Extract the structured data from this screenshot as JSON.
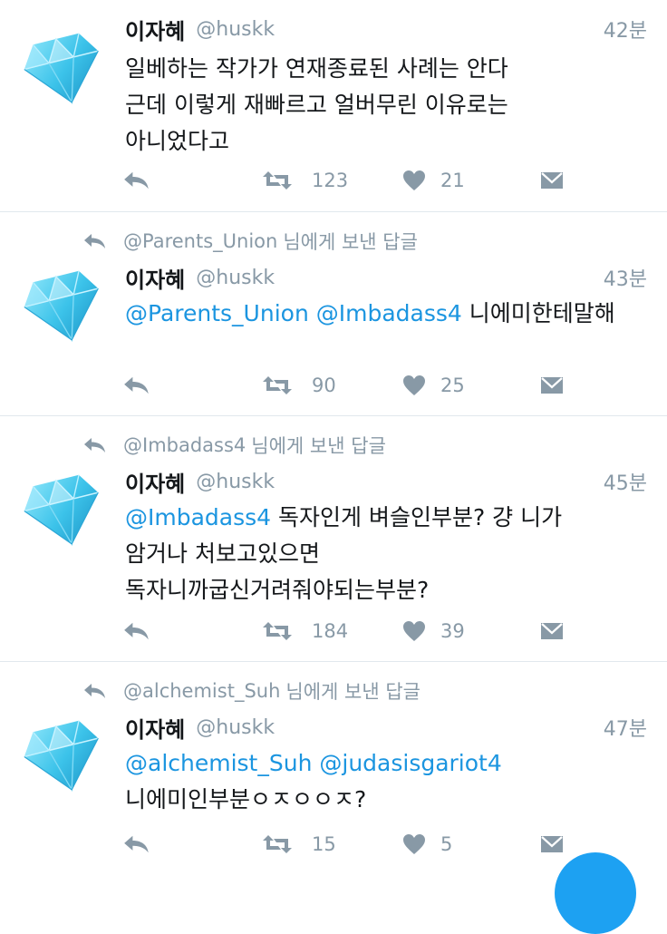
{
  "tweets": [
    {
      "reply_to": null,
      "name": "이자혜",
      "handle": "@huskk",
      "time": "42분",
      "lines": [
        [
          {
            "t": "일베하는 작가가 연재종료된 사례는 안다",
            "m": false
          }
        ],
        [
          {
            "t": "근데 이렇게 재빠르고 얼버무린 이유로는",
            "m": false
          }
        ],
        [
          {
            "t": "아니었다고",
            "m": false
          }
        ]
      ],
      "retweets": "123",
      "likes": "21"
    },
    {
      "reply_to": {
        "handle": "@Parents_Union",
        "suffix": "님에게 보낸 답글"
      },
      "name": "이자혜",
      "handle": "@huskk",
      "time": "43분",
      "lines": [
        [
          {
            "t": "@Parents_Union @Imbadass4",
            "m": true
          },
          {
            "t": " 니에미한테말해",
            "m": false
          }
        ]
      ],
      "retweets": "90",
      "likes": "25"
    },
    {
      "reply_to": {
        "handle": "@Imbadass4",
        "suffix": "님에게 보낸 답글"
      },
      "name": "이자혜",
      "handle": "@huskk",
      "time": "45분",
      "lines": [
        [
          {
            "t": "@Imbadass4",
            "m": true
          },
          {
            "t": " 독자인게 벼슬인부분? 걍 니가",
            "m": false
          }
        ],
        [
          {
            "t": "암거나 처보고있으면",
            "m": false
          }
        ],
        [
          {
            "t": "독자니까굽신거려줘야되는부분?",
            "m": false
          }
        ]
      ],
      "retweets": "184",
      "likes": "39"
    },
    {
      "reply_to": {
        "handle": "@alchemist_Suh",
        "suffix": "님에게 보낸 답글"
      },
      "name": "이자혜",
      "handle": "@huskk",
      "time": "47분",
      "lines": [
        [
          {
            "t": "@alchemist_Suh @judasisgariot4",
            "m": true
          }
        ],
        [
          {
            "t": "니에미인부분ㅇㅈㅇㅇㅈ?",
            "m": false
          }
        ]
      ],
      "retweets": "15",
      "likes": "5"
    }
  ],
  "icons": {
    "reply": "reply-arrow-icon",
    "retweet": "retweet-icon",
    "like": "heart-icon",
    "dm": "envelope-icon",
    "avatar": "diamond-gem-icon",
    "fab": "compose-button"
  },
  "colors": {
    "mention": "#1b95e0",
    "muted": "#8899a6",
    "text": "#14171a",
    "divider": "#e1e8ed",
    "fab": "#1da1f2",
    "gem": "#3cc3ea"
  }
}
